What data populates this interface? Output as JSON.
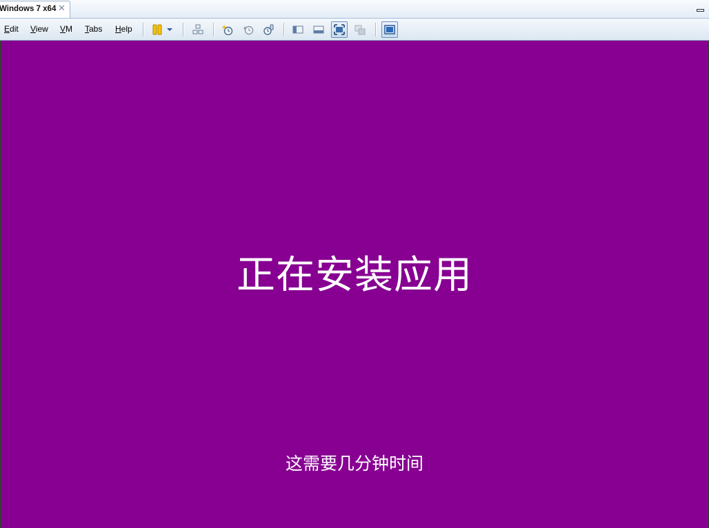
{
  "tabbar": {
    "tab_title": "Windows 7 x64",
    "close_glyph": "✕"
  },
  "menu": {
    "items": [
      {
        "label": "Edit"
      },
      {
        "label": "View"
      },
      {
        "label": "VM"
      },
      {
        "label": "Tabs"
      },
      {
        "label": "Help"
      }
    ]
  },
  "toolbar": {
    "buttons": [
      {
        "icon": "pause-icon"
      },
      {
        "icon": "dropdown-arrow-icon"
      },
      {
        "icon": "send-ctrl-alt-del-icon"
      },
      {
        "icon": "take-snapshot-icon"
      },
      {
        "icon": "revert-snapshot-icon"
      },
      {
        "icon": "snapshot-manager-icon"
      },
      {
        "icon": "show-library-icon"
      },
      {
        "icon": "thumbnail-bar-icon"
      },
      {
        "icon": "full-screen-icon"
      },
      {
        "icon": "unity-icon"
      },
      {
        "icon": "console-view-icon"
      }
    ]
  },
  "screen": {
    "background": "#870092",
    "title": "正在安装应用",
    "subtitle": "这需要几分钟时间"
  }
}
